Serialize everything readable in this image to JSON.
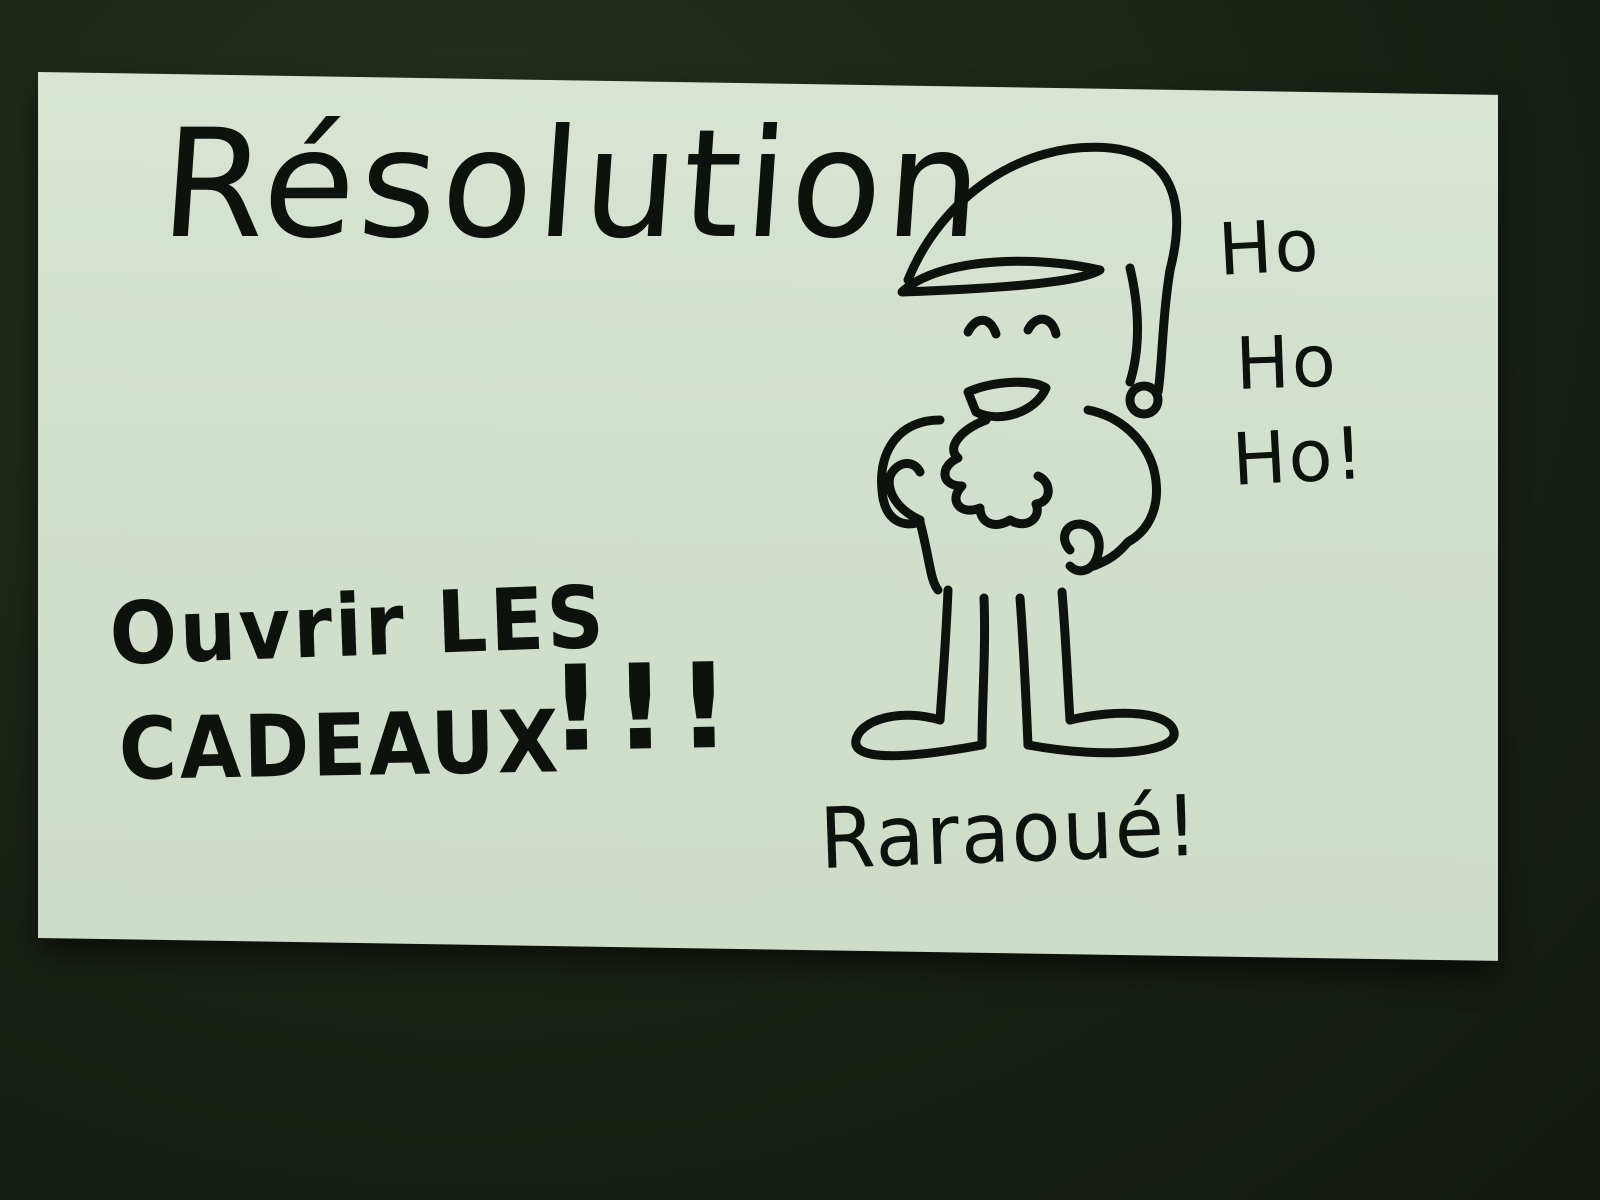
{
  "photo": {
    "background_color": "#1c2418",
    "card_color": "#d5e1cf",
    "ink_color": "#0d120c"
  },
  "card": {
    "title": "Résolution",
    "message_line1": "Ouvrir LES",
    "message_line2": "CADEAUX",
    "message_exclaim": "!!!",
    "speech_line1": "Ho",
    "speech_line2": "Ho",
    "speech_line3": "Ho!",
    "signature": "Raraoué!"
  },
  "illustration": {
    "icon": "gnome-drawing-icon"
  }
}
